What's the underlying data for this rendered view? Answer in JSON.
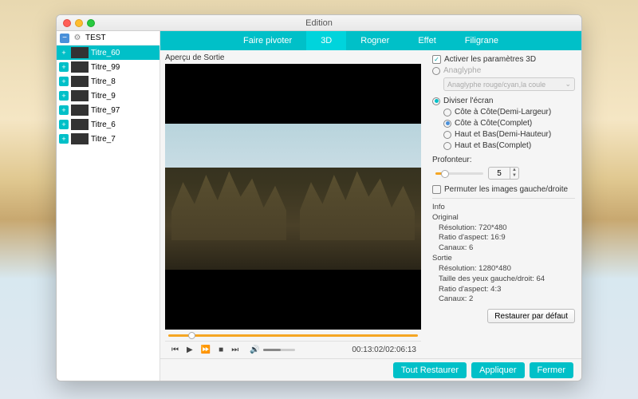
{
  "window": {
    "title": "Edition"
  },
  "sidebar": {
    "header_label": "TEST",
    "items": [
      {
        "label": "Titre_60"
      },
      {
        "label": "Titre_99"
      },
      {
        "label": "Titre_8"
      },
      {
        "label": "Titre_9"
      },
      {
        "label": "Titre_97"
      },
      {
        "label": "Titre_6"
      },
      {
        "label": "Titre_7"
      }
    ]
  },
  "tabs": {
    "rotate": "Faire pivoter",
    "threeD": "3D",
    "crop": "Rogner",
    "effect": "Effet",
    "watermark": "Filigrane"
  },
  "preview": {
    "label": "Aperçu de Sortie",
    "time": "00:13:02/02:06:13"
  },
  "settings": {
    "enable3d": "Activer les paramètres 3D",
    "anaglyph": "Anaglyphe",
    "anaglyph_dropdown": "Anaglyphe rouge/cyan,la coule",
    "split_screen": "Diviser l'écran",
    "opts": {
      "sbs_half": "Côte à Côte(Demi-Largeur)",
      "sbs_full": "Côte à Côte(Complet)",
      "tb_half": "Haut et Bas(Demi-Hauteur)",
      "tb_full": "Haut et Bas(Complet)"
    },
    "depth_label": "Profonteur:",
    "depth_value": "5",
    "swap": "Permuter les images gauche/droite",
    "info_header": "Info",
    "orig_header": "Original",
    "orig_res": "Résolution: 720*480",
    "orig_ratio": "Ratio d'aspect: 16:9",
    "orig_ch": "Canaux: 6",
    "out_header": "Sortie",
    "out_res": "Résolution: 1280*480",
    "out_eye": "Taille des yeux gauche/droit: 64",
    "out_ratio": "Ratio d'aspect: 4:3",
    "out_ch": "Canaux: 2",
    "restore": "Restaurer par défaut"
  },
  "footer": {
    "restore_all": "Tout Restaurer",
    "apply": "Appliquer",
    "close": "Fermer"
  }
}
